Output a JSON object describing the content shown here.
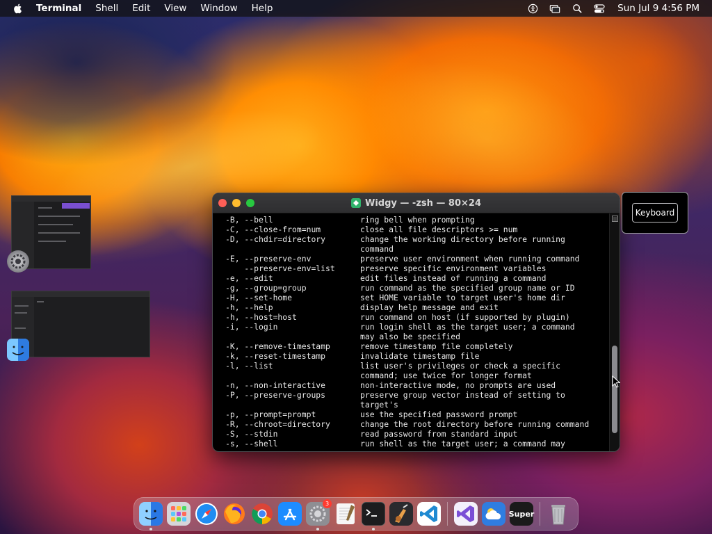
{
  "menubar": {
    "app_name": "Terminal",
    "menus": [
      "Shell",
      "Edit",
      "View",
      "Window",
      "Help"
    ],
    "clock": "Sun Jul 9  4:56 PM"
  },
  "window": {
    "title": "Widgy — -zsh — 80×24"
  },
  "terminal": {
    "lines": [
      {
        "opt": "-B, --bell",
        "desc": "ring bell when prompting"
      },
      {
        "opt": "-C, --close-from=num",
        "desc": "close all file descriptors >= num"
      },
      {
        "opt": "-D, --chdir=directory",
        "desc": "change the working directory before running"
      },
      {
        "opt": "",
        "desc": "command"
      },
      {
        "opt": "-E, --preserve-env",
        "desc": "preserve user environment when running command"
      },
      {
        "opt": "    --preserve-env=list",
        "desc": "preserve specific environment variables"
      },
      {
        "opt": "-e, --edit",
        "desc": "edit files instead of running a command"
      },
      {
        "opt": "-g, --group=group",
        "desc": "run command as the specified group name or ID"
      },
      {
        "opt": "-H, --set-home",
        "desc": "set HOME variable to target user's home dir"
      },
      {
        "opt": "-h, --help",
        "desc": "display help message and exit"
      },
      {
        "opt": "-h, --host=host",
        "desc": "run command on host (if supported by plugin)"
      },
      {
        "opt": "-i, --login",
        "desc": "run login shell as the target user; a command"
      },
      {
        "opt": "",
        "desc": "may also be specified"
      },
      {
        "opt": "-K, --remove-timestamp",
        "desc": "remove timestamp file completely"
      },
      {
        "opt": "-k, --reset-timestamp",
        "desc": "invalidate timestamp file"
      },
      {
        "opt": "-l, --list",
        "desc": "list user's privileges or check a specific"
      },
      {
        "opt": "",
        "desc": "command; use twice for longer format"
      },
      {
        "opt": "-n, --non-interactive",
        "desc": "non-interactive mode, no prompts are used"
      },
      {
        "opt": "-P, --preserve-groups",
        "desc": "preserve group vector instead of setting to"
      },
      {
        "opt": "",
        "desc": "target's"
      },
      {
        "opt": "-p, --prompt=prompt",
        "desc": "use the specified password prompt"
      },
      {
        "opt": "-R, --chroot=directory",
        "desc": "change the root directory before running command"
      },
      {
        "opt": "-S, --stdin",
        "desc": "read password from standard input"
      },
      {
        "opt": "-s, --shell",
        "desc": "run shell as the target user; a command may"
      }
    ]
  },
  "keyboard_hud": {
    "label": "Keyboard"
  },
  "dock": {
    "items": [
      {
        "name": "finder-icon",
        "color": "#2d8cf0",
        "running": true
      },
      {
        "name": "launchpad-icon",
        "color": "#c8c8cc",
        "running": false
      },
      {
        "name": "safari-icon",
        "color": "#1e8ef5",
        "running": false
      },
      {
        "name": "firefox-icon",
        "color": "#ff7a1a",
        "running": false
      },
      {
        "name": "chrome-icon",
        "color": "#e8e8e8",
        "running": false
      },
      {
        "name": "app-store-icon",
        "color": "#1a8cff",
        "running": false
      },
      {
        "name": "system-settings-icon",
        "color": "#8e8e93",
        "running": true,
        "badge": "3"
      },
      {
        "name": "textedit-icon",
        "color": "#f2f2f2",
        "running": false
      },
      {
        "name": "terminal-icon",
        "color": "#1c1c1e",
        "running": true
      },
      {
        "name": "instruments-icon",
        "color": "#3a2a1a",
        "running": false
      },
      {
        "name": "vscode-icon",
        "color": "#ffffff",
        "running": false
      },
      {
        "name": "visual-studio-icon",
        "color": "#ffffff",
        "running": false
      },
      {
        "name": "weather-icon",
        "color": "#2f7de0",
        "running": false
      },
      {
        "name": "super-icon",
        "color": "#1a1a1a",
        "running": false,
        "label": "Super"
      },
      {
        "name": "trash-icon",
        "color": "#b8b8bd",
        "running": false
      }
    ]
  }
}
